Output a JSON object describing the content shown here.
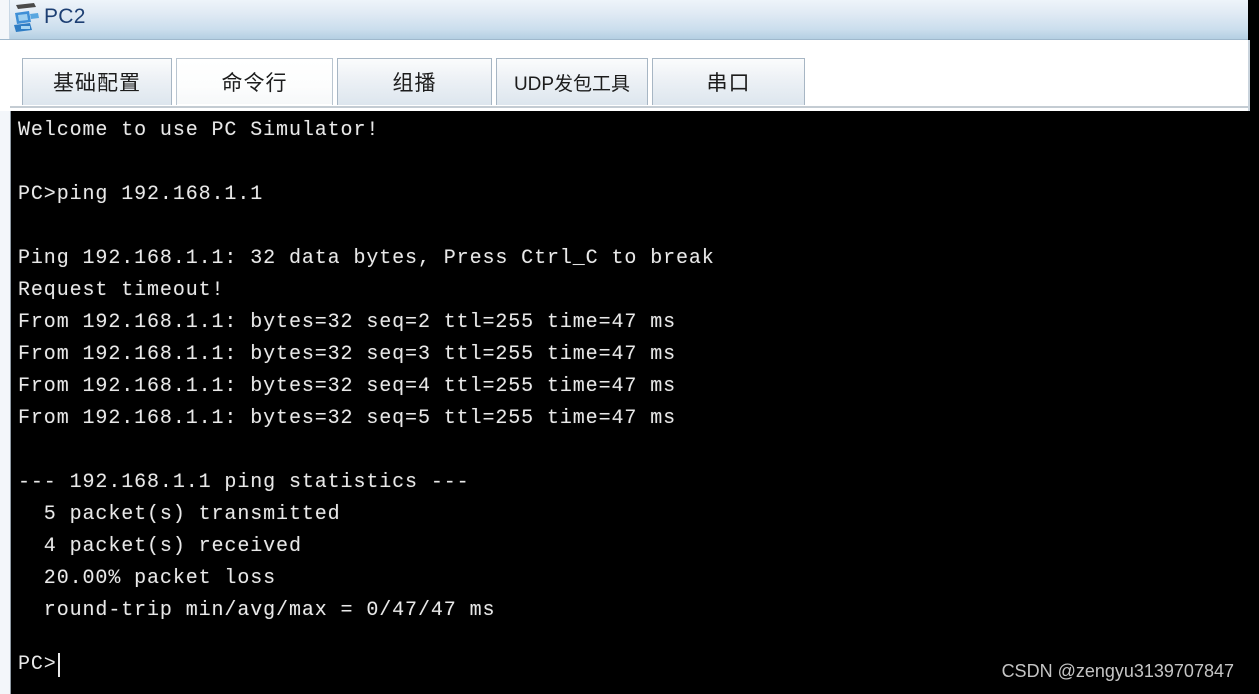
{
  "window": {
    "title": "PC2",
    "icon": "pc-computer-icon"
  },
  "tabs": [
    {
      "id": "basic-config",
      "label": "基础配置",
      "active": false
    },
    {
      "id": "command-line",
      "label": "命令行",
      "active": true
    },
    {
      "id": "multicast",
      "label": "组播",
      "active": false
    },
    {
      "id": "udp-tool",
      "label": "UDP发包工具",
      "active": false
    },
    {
      "id": "serial-port",
      "label": "串口",
      "active": false
    }
  ],
  "terminal": {
    "lines": [
      "Welcome to use PC Simulator!",
      "",
      "PC>ping 192.168.1.1",
      "",
      "Ping 192.168.1.1: 32 data bytes, Press Ctrl_C to break",
      "Request timeout!",
      "From 192.168.1.1: bytes=32 seq=2 ttl=255 time=47 ms",
      "From 192.168.1.1: bytes=32 seq=3 ttl=255 time=47 ms",
      "From 192.168.1.1: bytes=32 seq=4 ttl=255 time=47 ms",
      "From 192.168.1.1: bytes=32 seq=5 ttl=255 time=47 ms",
      "",
      "--- 192.168.1.1 ping statistics ---",
      "  5 packet(s) transmitted",
      "  4 packet(s) received",
      "  20.00% packet loss",
      "  round-trip min/avg/max = 0/47/47 ms"
    ],
    "prompt": "PC>",
    "command_value": ""
  },
  "watermark": {
    "text": "CSDN @zengyu3139707847"
  },
  "colors": {
    "terminal_background": "#000000",
    "terminal_text": "#e9e9e9",
    "titlebar_text": "#1d3f73",
    "titlebar_top": "#eef4fa",
    "titlebar_bottom": "#b4cfe2",
    "tab_border": "#a7b6c4"
  }
}
